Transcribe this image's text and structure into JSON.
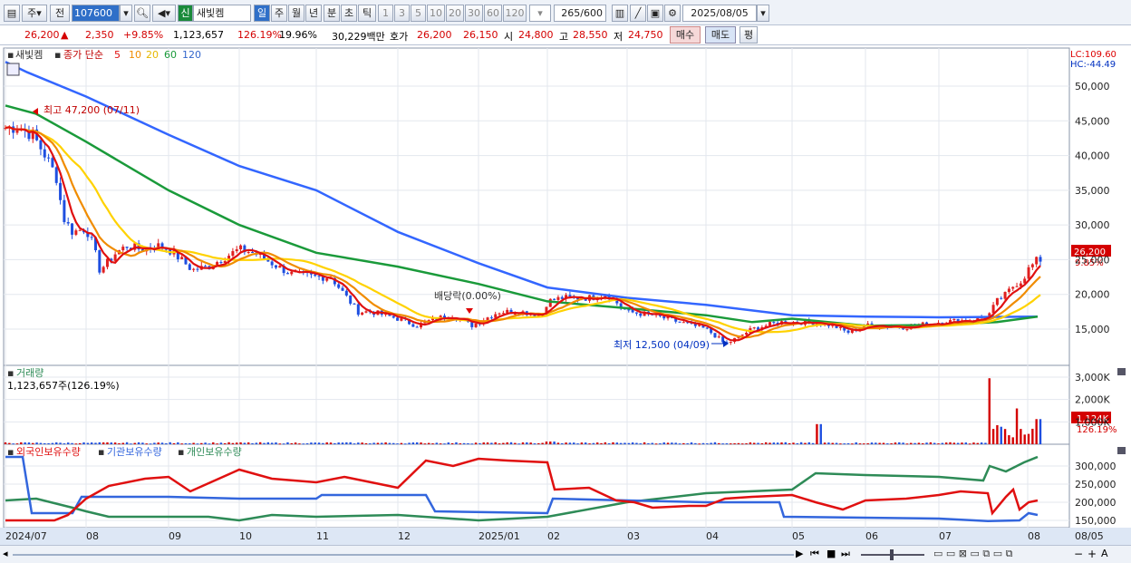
{
  "toolbar": {
    "market_btn": "주",
    "prev_btn": "전",
    "code_value": "107600",
    "badge": "신",
    "stock_name": "새빛켐",
    "period_tabs": [
      "일",
      "주",
      "월",
      "년",
      "분",
      "초",
      "틱"
    ],
    "interval_buttons": [
      "1",
      "3",
      "5",
      "10",
      "20",
      "30",
      "60",
      "120"
    ],
    "count_value": "265",
    "count_max": "/600",
    "date_value": "2025/08/05"
  },
  "quote": {
    "price": "26,200",
    "price_arrow": "▲",
    "change": "2,350",
    "change_pct": "+9.85%",
    "volume": "1,123,657",
    "volume_ratio": "126.19%",
    "turnover": "19.96%",
    "amount": "30,229백만",
    "bid_label": "호가",
    "ask_price": "26,200",
    "bid_price": "26,150",
    "open_label": "시",
    "open_price": "24,800",
    "high_label": "고",
    "high_price": "28,550",
    "low_label": "저",
    "low_price": "24,750",
    "buy_btn": "매수",
    "sell_btn": "매도",
    "eval_btn": "평"
  },
  "price_panel": {
    "title_name": "새빛켐",
    "ma_label": "종가 단순",
    "ma_periods": [
      "5",
      "10",
      "20",
      "60",
      "120"
    ],
    "ma_colors": [
      "#e01010",
      "#f08c00",
      "#ffd200",
      "#1a9a3a",
      "#3366ff"
    ],
    "lc_label": "LC:109.60",
    "hc_label": "HC:-44.49",
    "high_annotation": "최고 47,200 (07/11)",
    "low_annotation": "최저 12,500 (04/09)",
    "dividend_annotation": "배당락(0.00%)",
    "price_tag": "26,200",
    "pct_tag": "9.85%",
    "y_ticks": [
      "50,000",
      "45,000",
      "40,000",
      "35,000",
      "30,000",
      "25,000",
      "20,000",
      "15,000"
    ]
  },
  "volume_panel": {
    "title": "거래량",
    "current": "1,123,657주(126.19%)",
    "y_ticks": [
      "3,000K",
      "2,000K",
      "1,000K"
    ],
    "vol_tag": "1,124K",
    "ratio_tag": "126.19%"
  },
  "holdings_panel": {
    "legend": [
      "외국인보유수량",
      "기관보유수량",
      "개인보유수량"
    ],
    "legend_colors": [
      "#e01010",
      "#3366dd",
      "#2e8b57"
    ],
    "y_ticks": [
      "300,000",
      "250,000",
      "200,000",
      "150,000"
    ]
  },
  "x_axis": {
    "labels": [
      "2024/07",
      "08",
      "09",
      "10",
      "11",
      "12",
      "2025/01",
      "02",
      "03",
      "04",
      "05",
      "06",
      "07",
      "08"
    ],
    "right_label": "08/05"
  },
  "chart_data": {
    "type": "line",
    "price_axis": {
      "ylim": [
        11500,
        54000
      ],
      "y_ticks": [
        50000,
        45000,
        40000,
        35000,
        30000,
        25000,
        20000,
        15000
      ]
    },
    "close_approx": [
      {
        "x": "2024/07",
        "y": 44000
      },
      {
        "x": "07/11",
        "y": 47200
      },
      {
        "x": "08",
        "y": 30000
      },
      {
        "x": "09",
        "y": 26500
      },
      {
        "x": "10",
        "y": 27000
      },
      {
        "x": "11",
        "y": 22500
      },
      {
        "x": "12",
        "y": 16500
      },
      {
        "x": "2025/01",
        "y": 16500
      },
      {
        "x": "02",
        "y": 19500
      },
      {
        "x": "03",
        "y": 17000
      },
      {
        "x": "04/09",
        "y": 12500
      },
      {
        "x": "05",
        "y": 16000
      },
      {
        "x": "06",
        "y": 15500
      },
      {
        "x": "07",
        "y": 16500
      },
      {
        "x": "08/05",
        "y": 26200
      }
    ],
    "volume_axis": {
      "y_ticks": [
        3000,
        2000,
        1000
      ],
      "unit": "K"
    },
    "holdings_axis": {
      "y_ticks": [
        300000,
        250000,
        200000,
        150000
      ]
    }
  }
}
